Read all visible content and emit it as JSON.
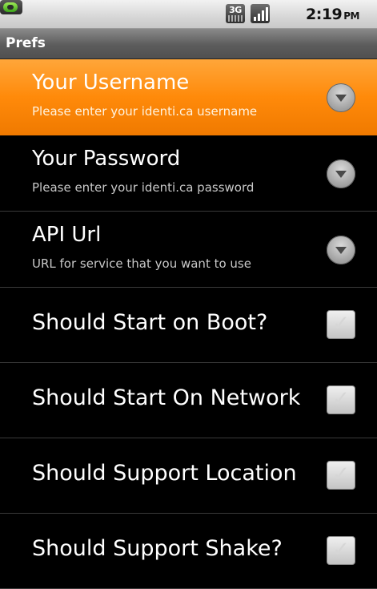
{
  "status_bar": {
    "network": "3G",
    "time": "2:19",
    "ampm": "PM"
  },
  "title_bar": {
    "title": "Prefs"
  },
  "prefs": [
    {
      "title": "Your Username",
      "summary": "Please enter your identi.ca username",
      "widget": "chevron",
      "selected": true
    },
    {
      "title": "Your Password",
      "summary": "Please enter your identi.ca password",
      "widget": "chevron",
      "selected": false
    },
    {
      "title": "API Url",
      "summary": "URL for service that you want to use",
      "widget": "chevron",
      "selected": false
    },
    {
      "title": "Should Start on Boot?",
      "widget": "checkbox",
      "checked": false
    },
    {
      "title": "Should Start On Network",
      "widget": "checkbox",
      "checked": false
    },
    {
      "title": "Should Support Location",
      "widget": "checkbox",
      "checked": false
    },
    {
      "title": "Should Support Shake?",
      "widget": "checkbox",
      "checked": false
    }
  ]
}
